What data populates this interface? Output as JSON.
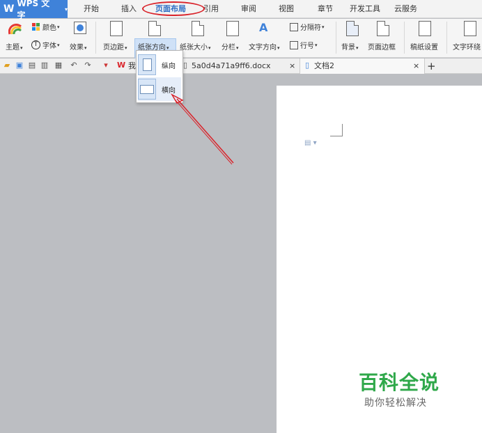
{
  "app": {
    "title": "WPS 文字",
    "caret": "▾"
  },
  "menu_tabs": [
    "开始",
    "插入",
    "页面布局",
    "引用",
    "审阅",
    "视图",
    "章节",
    "开发工具",
    "云服务"
  ],
  "active_tab": "页面布局",
  "ribbon": {
    "theme": "主题",
    "color": "颜色",
    "font": "字体",
    "effect": "效果",
    "margin": "页边距",
    "orientation": "纸张方向",
    "paper_size": "纸张大小",
    "columns": "分栏",
    "text_direction": "文字方向",
    "separator": "分隔符",
    "line_number": "行号",
    "background": "背景",
    "page_border": "页面边框",
    "draft_setting": "稿纸设置",
    "text_wrap": "文字环绕"
  },
  "doc_tabs": {
    "partial_tab": "我",
    "file_tab": "5a0d4a71a9ff6.docx",
    "active_tab": "文档2",
    "close_glyph": "×",
    "new_tab_glyph": "+"
  },
  "orientation_dropdown": {
    "portrait": "纵向",
    "landscape": "横向"
  },
  "watermark": {
    "title": "百科全说",
    "subtitle": "助你轻松解决"
  },
  "colors": {
    "accent": "#3f82d9",
    "annotation": "#d9232a",
    "watermark_green": "#2fa84a"
  }
}
